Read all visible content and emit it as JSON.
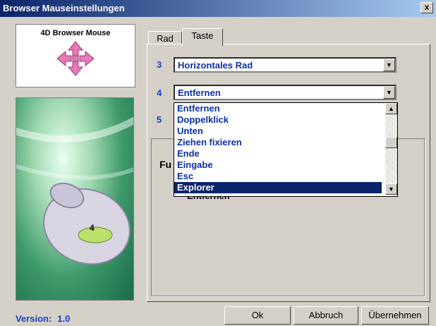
{
  "window": {
    "title": "Browser Mauseinstellungen",
    "close_label": "x"
  },
  "logo": {
    "title": "4D Browser Mouse"
  },
  "tabs": [
    {
      "label": "Rad",
      "active": false
    },
    {
      "label": "Taste",
      "active": true
    }
  ],
  "rows": [
    {
      "number": "3",
      "value": "Horizontales Rad"
    },
    {
      "number": "4",
      "value": "Entfernen"
    },
    {
      "number": "5",
      "value": ""
    }
  ],
  "group": {
    "label_partial": "Fu",
    "current_value": "Entfernen"
  },
  "dropdown": {
    "options": [
      "Entfernen",
      "Doppelklick",
      "Unten",
      "Ziehen fixieren",
      "Ende",
      "Eingabe",
      "Esc",
      "Explorer"
    ],
    "selected_index": 7
  },
  "image": {
    "button_label": "4"
  },
  "footer": {
    "version_label": "Version:",
    "version_value": "1.0"
  },
  "buttons": {
    "ok": "Ok",
    "cancel": "Abbruch",
    "apply": "Übernehmen"
  },
  "icons": {
    "close": "close-icon",
    "logo_arrows": "four-way-arrow-icon",
    "dropdown_arrow": "chevron-down-icon",
    "scroll_up": "scroll-up-icon",
    "scroll_down": "scroll-down-icon"
  },
  "colors": {
    "titlebar": "#0a246a",
    "text_blue": "#0b2ea8",
    "selection": "#0a246a",
    "face": "#d4d0c8"
  }
}
